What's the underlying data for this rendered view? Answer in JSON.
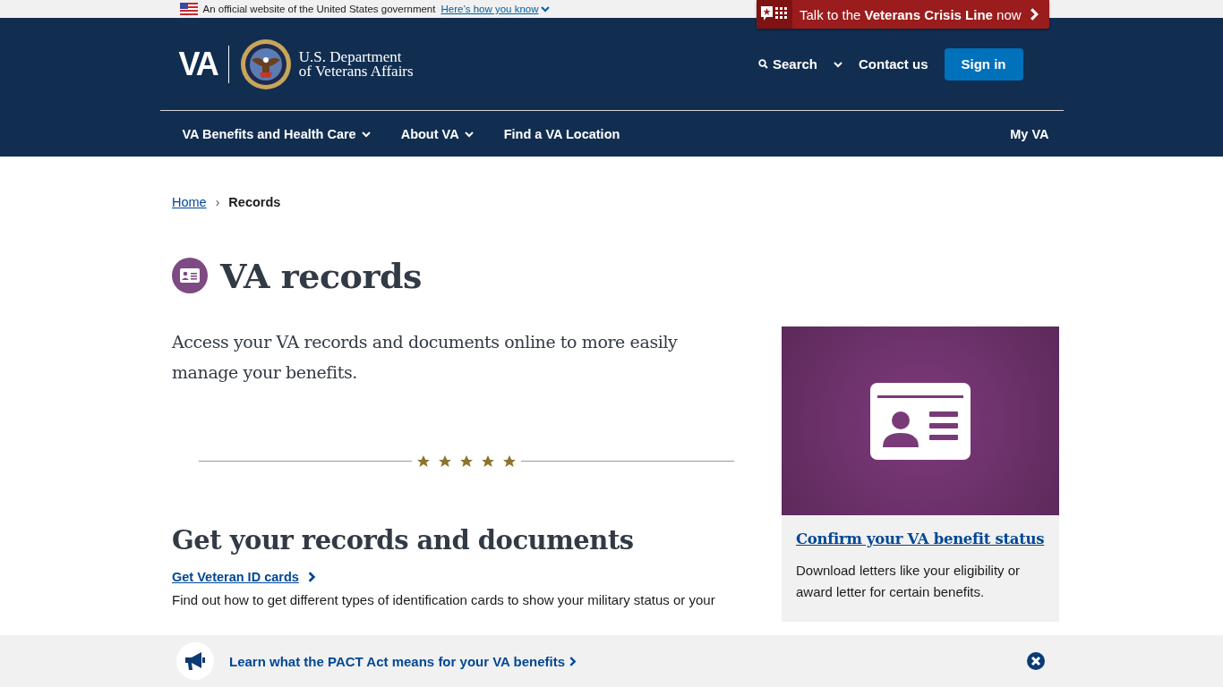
{
  "official_banner": {
    "text": "An official website of the United States government",
    "link": "Here’s how you know"
  },
  "crisis_line": {
    "text": "Talk to the **Veterans Crisis Line** now"
  },
  "header": {
    "logo_text": "VA",
    "department": [
      "U.S. Department",
      "of Veterans Affairs"
    ],
    "search": "Search",
    "contact": "Contact us",
    "sign_in": "Sign in"
  },
  "nav": [
    {
      "label": "VA Benefits and Health Care",
      "dropdown": true
    },
    {
      "label": "About VA",
      "dropdown": true
    },
    {
      "label": "Find a VA Location",
      "dropdown": false
    }
  ],
  "nav_right": "My VA",
  "breadcrumb": [
    {
      "label": "Home",
      "current": false
    },
    {
      "label": "Records",
      "current": true
    }
  ],
  "breadcrumb_separator": "›",
  "title": "VA records",
  "intro": "Access your VA records and documents online to more easily manage your benefits.",
  "section_heading": "Get your records and documents",
  "links": [
    {
      "label": "Get Veteran ID cards",
      "description": "Find out how to get different types of identification cards to show your military status or your"
    }
  ],
  "card": {
    "title": "Confirm your VA benefit status",
    "text": "Download letters like your eligibility or award letter for certain benefits."
  },
  "promo_banner": {
    "text": "Learn what the PACT Act means for your VA benefits"
  }
}
